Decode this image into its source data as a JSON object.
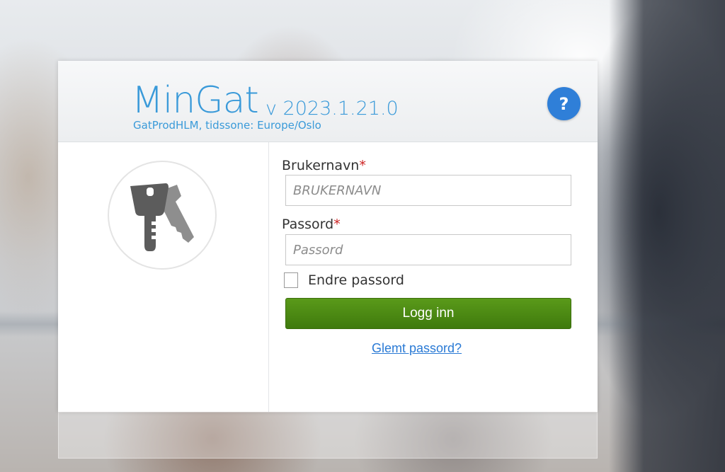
{
  "header": {
    "app_name": "MinGat",
    "version": "v 2023.1.21.0",
    "server_info": "GatProdHLM, tidssone: Europe/Oslo",
    "help_label": "?"
  },
  "login": {
    "username_label": "Brukernavn",
    "username_placeholder": "BRUKERNAVN",
    "username_value": "",
    "password_label": "Passord",
    "password_placeholder": "Passord",
    "password_value": "",
    "required_marker": "*",
    "change_password_label": "Endre passord",
    "change_password_checked": false,
    "submit_label": "Logg inn",
    "forgot_label": "Glemt passord?"
  },
  "icons": {
    "help": "question-mark-icon",
    "keys": "keys-icon"
  },
  "colors": {
    "brand_blue": "#3a9ad9",
    "help_blue": "#2f7fd8",
    "login_green": "#4a8a14",
    "required_red": "#cc2222",
    "link_blue": "#2a7ad5"
  }
}
